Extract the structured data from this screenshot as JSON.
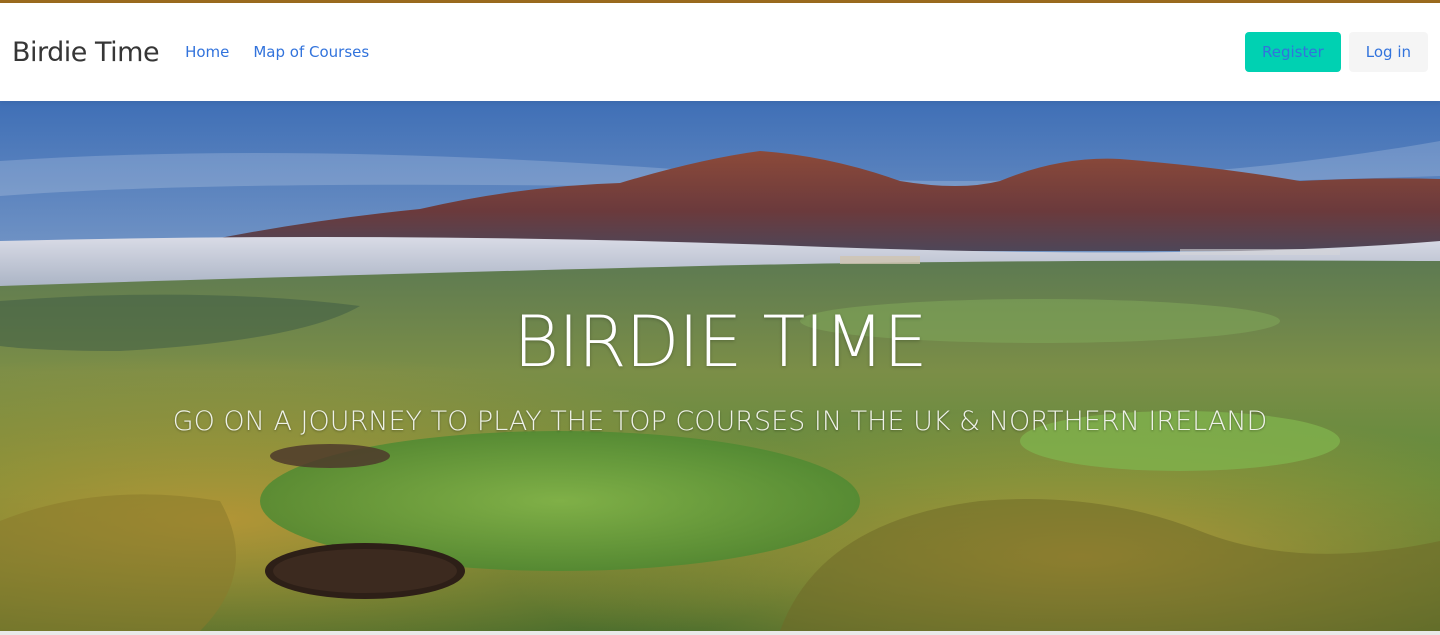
{
  "navbar": {
    "brand": "Birdie Time",
    "links": [
      {
        "label": "Home"
      },
      {
        "label": "Map of Courses"
      }
    ],
    "register_label": "Register",
    "login_label": "Log in"
  },
  "hero": {
    "title": "BIRDIE TIME",
    "subtitle": "GO ON A JOURNEY TO PLAY THE TOP COURSES IN THE UK & NORTHERN IRELAND"
  },
  "colors": {
    "accent_rule": "#9a6a1e",
    "link": "#3273dc",
    "register_bg": "#00d1b2",
    "login_bg": "#f5f5f5"
  }
}
